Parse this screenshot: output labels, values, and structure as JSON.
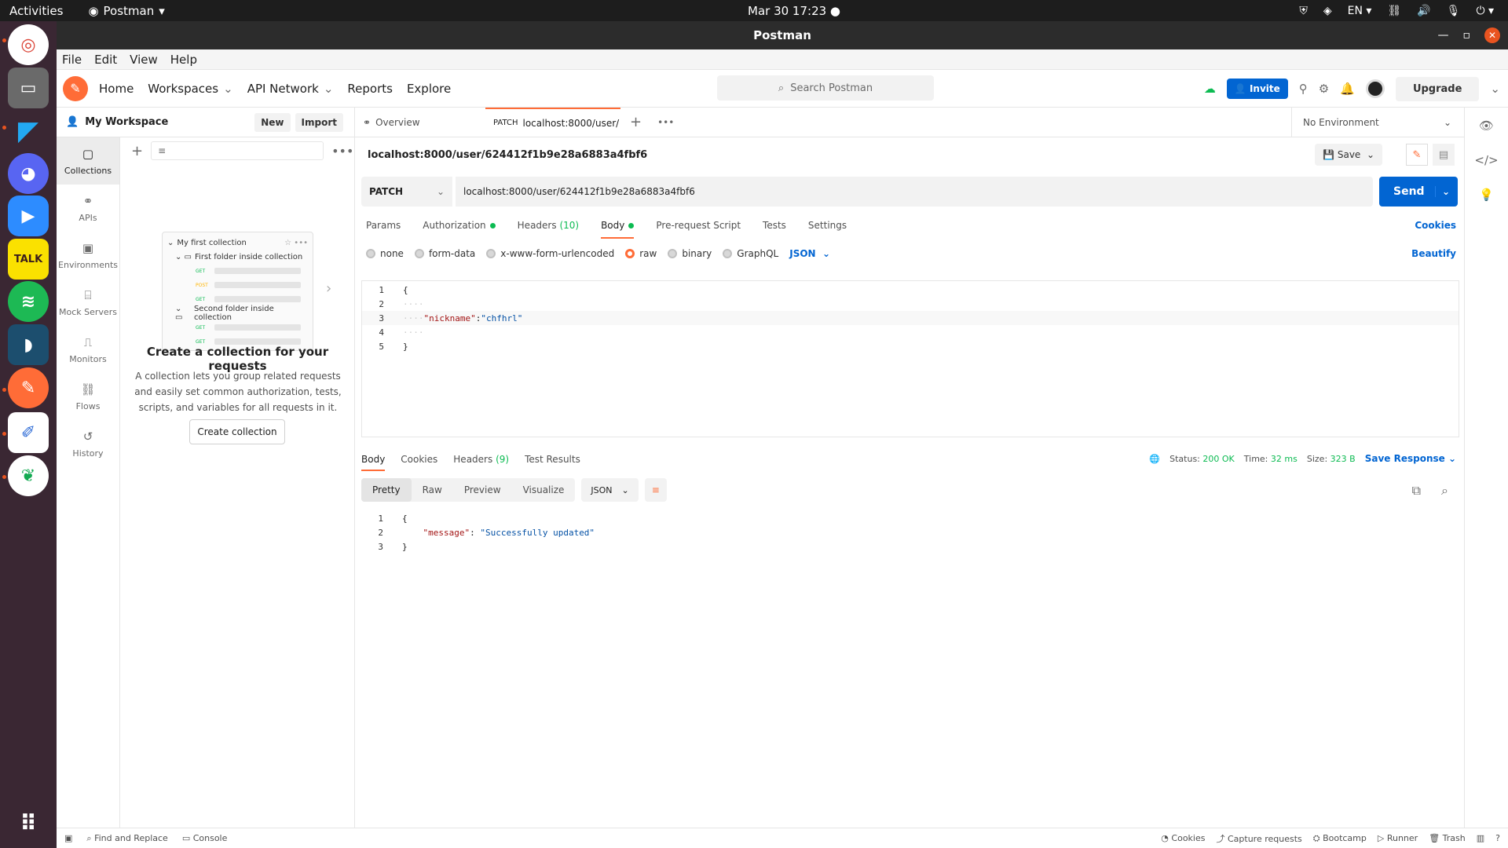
{
  "os": {
    "activities": "Activities",
    "app_name": "Postman",
    "clock": "Mar 30  17:23",
    "lang": "EN"
  },
  "window": {
    "title": "Postman"
  },
  "menu": [
    "File",
    "Edit",
    "View",
    "Help"
  ],
  "header": {
    "nav": [
      "Home",
      "Workspaces",
      "API Network",
      "Reports",
      "Explore"
    ],
    "search_placeholder": "Search Postman",
    "invite": "Invite",
    "upgrade": "Upgrade"
  },
  "sidebar": {
    "workspace": "My Workspace",
    "new": "New",
    "import": "Import",
    "rail": [
      "Collections",
      "APIs",
      "Environments",
      "Mock Servers",
      "Monitors",
      "Flows",
      "History"
    ],
    "preview": {
      "collection": "My first collection",
      "folder1": "First folder inside collection",
      "folder2": "Second folder inside collection",
      "methods": [
        "GET",
        "POST",
        "GET",
        "GET",
        "GET"
      ]
    },
    "empty_title": "Create a collection for your requests",
    "empty_desc": "A collection lets you group related requests and easily set common authorization, tests, scripts, and variables for all requests in it.",
    "create_button": "Create collection"
  },
  "tabs": {
    "overview": "Overview",
    "active_method": "PATCH",
    "active_url": "localhost:8000/user/",
    "environment": "No Environment"
  },
  "request": {
    "title": "localhost:8000/user/624412f1b9e28a6883a4fbf6",
    "save": "Save",
    "method": "PATCH",
    "url": "localhost:8000/user/624412f1b9e28a6883a4fbf6",
    "send": "Send",
    "tabs": [
      "Params",
      "Authorization",
      "Headers",
      "Body",
      "Pre-request Script",
      "Tests",
      "Settings"
    ],
    "headers_count": "(10)",
    "cookies": "Cookies",
    "body_types": [
      "none",
      "form-data",
      "x-www-form-urlencoded",
      "raw",
      "binary",
      "GraphQL"
    ],
    "body_format": "JSON",
    "beautify": "Beautify",
    "body_lines": [
      "1",
      "2",
      "3",
      "4",
      "5"
    ],
    "body_key": "\"nickname\"",
    "body_val": "\"chfhrl\""
  },
  "response": {
    "tabs": [
      "Body",
      "Cookies",
      "Headers",
      "Test Results"
    ],
    "headers_count": "(9)",
    "status_label": "Status:",
    "status": "200 OK",
    "time_label": "Time:",
    "time": "32 ms",
    "size_label": "Size:",
    "size": "323 B",
    "save_response": "Save Response",
    "views": [
      "Pretty",
      "Raw",
      "Preview",
      "Visualize"
    ],
    "format": "JSON",
    "lines": [
      "1",
      "2",
      "3"
    ],
    "message_key": "\"message\"",
    "message_val": "\"Successfully updated\""
  },
  "statusbar": {
    "find_replace": "Find and Replace",
    "console": "Console",
    "right": [
      "Cookies",
      "Capture requests",
      "Bootcamp",
      "Runner",
      "Trash"
    ]
  },
  "colors": {
    "accent": "#ff6c37",
    "primary": "#0265d2",
    "success": "#0cbb52"
  }
}
